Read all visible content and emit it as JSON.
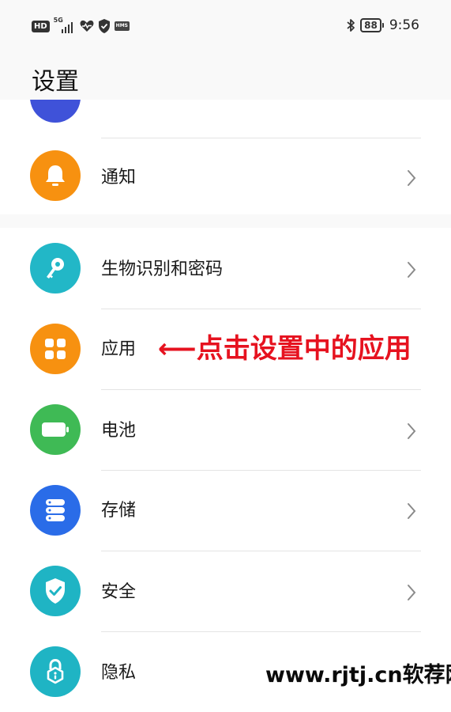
{
  "status_bar": {
    "hd_label": "HD",
    "network_label": "5G",
    "hms_label": "HMS",
    "battery_level": "88",
    "time": "9:56",
    "icons": [
      "hd-icon",
      "signal-icon",
      "health-icon",
      "shield-icon",
      "hms-icon",
      "bluetooth-icon",
      "battery-icon"
    ]
  },
  "page": {
    "title": "设置"
  },
  "items": [
    {
      "id": "notifications",
      "label": "通知",
      "icon": "bell-icon",
      "color": "#f79110"
    },
    {
      "id": "biometrics",
      "label": "生物识别和密码",
      "icon": "key-icon",
      "color": "#22b7c7"
    },
    {
      "id": "apps",
      "label": "应用",
      "icon": "grid-icon",
      "color": "#f79110"
    },
    {
      "id": "battery",
      "label": "电池",
      "icon": "battery-icon",
      "color": "#3fba55"
    },
    {
      "id": "storage",
      "label": "存储",
      "icon": "database-icon",
      "color": "#2a6ce8"
    },
    {
      "id": "security",
      "label": "安全",
      "icon": "shield-check-icon",
      "color": "#1fb4c4"
    },
    {
      "id": "privacy",
      "label": "隐私",
      "icon": "lock-icon",
      "color": "#1fb4c4"
    }
  ],
  "annotation": {
    "text": "⟵点击设置中的应用",
    "color": "#e6121f"
  },
  "watermark": {
    "text": "www.rjtj.cn软荐网"
  }
}
